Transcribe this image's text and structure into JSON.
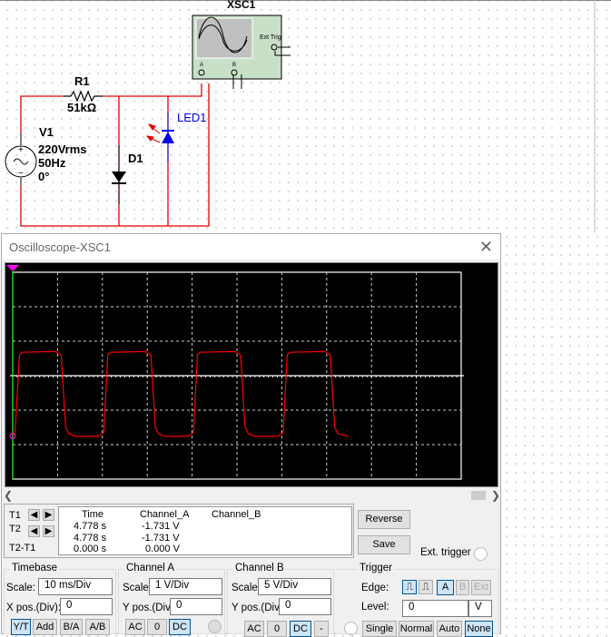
{
  "circuit": {
    "instrument_label": "XSC1",
    "ext_trig_label": "Ext Trig",
    "port_a": "A",
    "port_b": "B",
    "resistor": {
      "name": "R1",
      "value": "51kΩ"
    },
    "source": {
      "name": "V1",
      "voltage": "220Vrms",
      "frequency": "50Hz",
      "phase": "0°"
    },
    "diode": {
      "name": "D1"
    },
    "led": {
      "name": "LED1"
    },
    "colors": {
      "wire": "#e00000",
      "led": "#0000ee",
      "instrument_bg": "#c8e0c8"
    }
  },
  "window": {
    "title": "Oscilloscope-XSC1",
    "close_icon": "close-icon"
  },
  "chart_data": {
    "type": "line",
    "x_unit": "ms",
    "y_unit": "V",
    "xlim": [
      0,
      100
    ],
    "ylim": [
      -3,
      3
    ],
    "grid": true,
    "background": "#000000",
    "trace_color": "#ff0000",
    "series": [
      {
        "channel": "Channel_A",
        "points": [
          [
            0,
            -1.75
          ],
          [
            0.5,
            -1.7
          ],
          [
            1.5,
            0.6
          ],
          [
            2,
            0.68
          ],
          [
            9.5,
            0.7
          ],
          [
            10.8,
            0.6
          ],
          [
            11.8,
            -1.5
          ],
          [
            12.5,
            -1.68
          ],
          [
            14,
            -1.76
          ],
          [
            19,
            -1.76
          ],
          [
            20.3,
            -1.65
          ],
          [
            21.2,
            0.6
          ],
          [
            21.8,
            0.68
          ],
          [
            29.5,
            0.7
          ],
          [
            30.8,
            0.6
          ],
          [
            31.8,
            -1.5
          ],
          [
            32.5,
            -1.68
          ],
          [
            34,
            -1.76
          ],
          [
            39,
            -1.76
          ],
          [
            40.3,
            -1.65
          ],
          [
            41.2,
            0.6
          ],
          [
            41.8,
            0.68
          ],
          [
            49.5,
            0.7
          ],
          [
            50.8,
            0.6
          ],
          [
            51.8,
            -1.5
          ],
          [
            52.5,
            -1.68
          ],
          [
            54,
            -1.76
          ],
          [
            59,
            -1.76
          ],
          [
            60.3,
            -1.65
          ],
          [
            61.2,
            0.6
          ],
          [
            61.8,
            0.68
          ],
          [
            69.5,
            0.7
          ],
          [
            70.8,
            0.6
          ],
          [
            71.8,
            -1.5
          ],
          [
            72.5,
            -1.68
          ],
          [
            74.9,
            -1.76
          ]
        ]
      }
    ]
  },
  "readout": {
    "t1": "T1",
    "t2": "T2",
    "t2t1": "T2-T1",
    "headers": [
      "Time",
      "Channel_A",
      "Channel_B"
    ],
    "rows": [
      [
        "4.778 s",
        "-1.731 V",
        ""
      ],
      [
        "4.778 s",
        "-1.731 V",
        ""
      ],
      [
        "0.000 s",
        "0.000 V",
        ""
      ]
    ]
  },
  "buttons": {
    "reverse": "Reverse",
    "save": "Save",
    "ext_trigger": "Ext. trigger"
  },
  "timebase": {
    "title": "Timebase",
    "scale_label": "Scale:",
    "scale": "10 ms/Div",
    "xpos_label": "X pos.(Div):",
    "xpos": "0",
    "modes": [
      "Y/T",
      "Add",
      "B/A",
      "A/B"
    ],
    "selected": "Y/T"
  },
  "channel_a": {
    "title": "Channel A",
    "scale_label": "Scale:",
    "scale": "1  V/Div",
    "ypos_label": "Y pos.(Div):",
    "ypos": "0",
    "coupling": [
      "AC",
      "0",
      "DC"
    ],
    "selected": "DC"
  },
  "channel_b": {
    "title": "Channel B",
    "scale_label": "Scale:",
    "scale": "5  V/Div",
    "ypos_label": "Y pos.(Div):",
    "ypos": "0",
    "coupling": [
      "AC",
      "0",
      "DC",
      "-"
    ],
    "selected": "DC"
  },
  "trigger": {
    "title": "Trigger",
    "edge_label": "Edge:",
    "sources": [
      "A",
      "B",
      "Ext"
    ],
    "source_selected": "A",
    "level_label": "Level:",
    "level": "0",
    "level_unit": "V",
    "modes": [
      "Single",
      "Normal",
      "Auto",
      "None"
    ],
    "mode_selected": "None"
  }
}
